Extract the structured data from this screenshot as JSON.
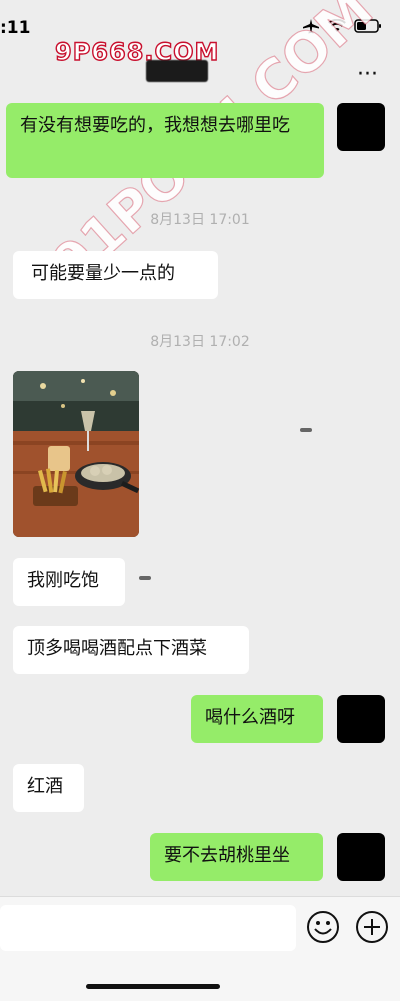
{
  "status_bar": {
    "time": ":11"
  },
  "watermarks": {
    "top": "9P668.COM",
    "diagonal": "91PORN.COM"
  },
  "messages": [
    {
      "id": "m1",
      "side": "out",
      "text": "有没有想要吃的，我想想去哪里吃"
    },
    {
      "id": "ts1",
      "type": "timestamp",
      "text": "8月13日 17:01"
    },
    {
      "id": "m2",
      "side": "in",
      "text": "可能要量少一点的"
    },
    {
      "id": "ts2",
      "type": "timestamp",
      "text": "8月13日 17:02"
    },
    {
      "id": "m3",
      "side": "in",
      "type": "image",
      "alt": "food and drink photo"
    },
    {
      "id": "m4",
      "side": "in",
      "text": "我刚吃饱"
    },
    {
      "id": "m5",
      "side": "in",
      "text": "顶多喝喝酒配点下酒菜"
    },
    {
      "id": "m6",
      "side": "out",
      "text": "喝什么酒呀"
    },
    {
      "id": "m7",
      "side": "in",
      "text": "红酒"
    },
    {
      "id": "m8",
      "side": "out",
      "text": "要不去胡桃里坐"
    }
  ],
  "input_bar": {
    "emoji_icon": "emoji-icon",
    "add_icon": "plus-icon"
  },
  "colors": {
    "outgoing_bubble": "#95ec69",
    "incoming_bubble": "#ffffff",
    "background": "#ededed"
  }
}
